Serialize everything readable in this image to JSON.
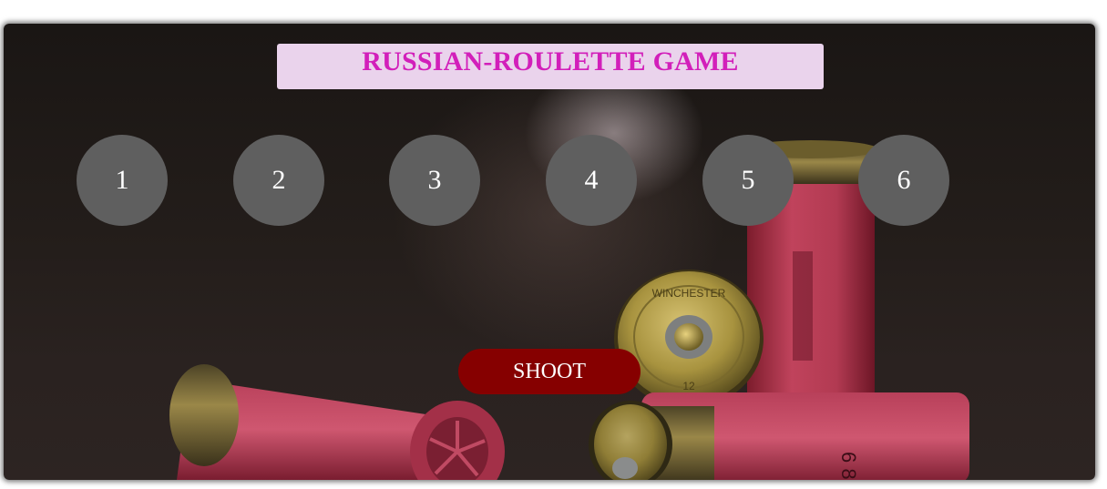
{
  "title": "RUSSIAN-ROULETTE GAME",
  "chambers": [
    "1",
    "2",
    "3",
    "4",
    "5",
    "6"
  ],
  "shoot_label": "SHOOT",
  "shell_stamps": {
    "brand": "WINCHESTER",
    "gauge": "12"
  },
  "colors": {
    "title_text": "#d21fba",
    "title_bg": "#ead3ec",
    "chamber_bg": "#5f5f5f",
    "shoot_bg": "#860000"
  }
}
